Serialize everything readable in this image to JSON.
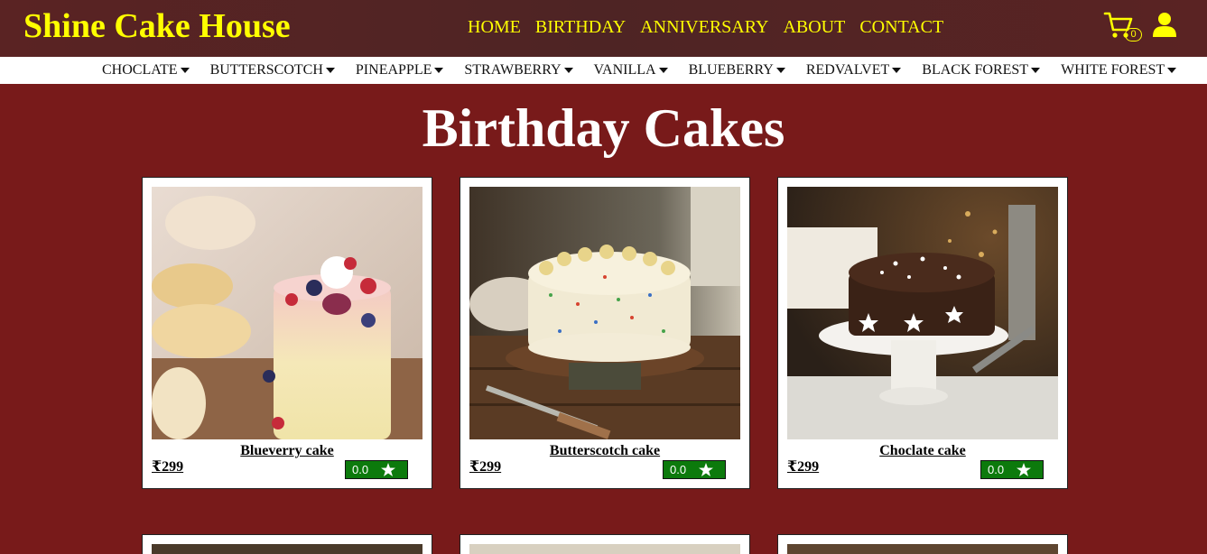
{
  "brand": "Shine Cake House",
  "main_nav": [
    "HOME",
    "BIRTHDAY",
    "ANNIVERSARY",
    "ABOUT",
    "CONTACT"
  ],
  "cart_count": "0",
  "flavors": [
    "CHOCLATE",
    "BUTTERSCOTCH",
    "PINEAPPLE",
    "STRAWBERRY",
    "VANILLA",
    "BLUEBERRY",
    "REDVALVET",
    "BLACK FOREST",
    "WHITE FOREST"
  ],
  "page_title": "Birthday Cakes",
  "products": [
    {
      "name": "Blueverry cake",
      "price": "₹299",
      "rating": "0.0"
    },
    {
      "name": "Butterscotch cake",
      "price": "₹299",
      "rating": "0.0"
    },
    {
      "name": "Choclate cake",
      "price": "₹299",
      "rating": "0.0"
    }
  ],
  "colors": {
    "header_bg": "#4e2424",
    "accent_yellow": "#ffff00",
    "page_bg": "#781a1a",
    "rating_green": "#0c7a0c"
  },
  "icons": {
    "cart": "cart-icon",
    "user": "user-icon",
    "rating": "star-icon",
    "dropdown": "caret-down-icon"
  }
}
